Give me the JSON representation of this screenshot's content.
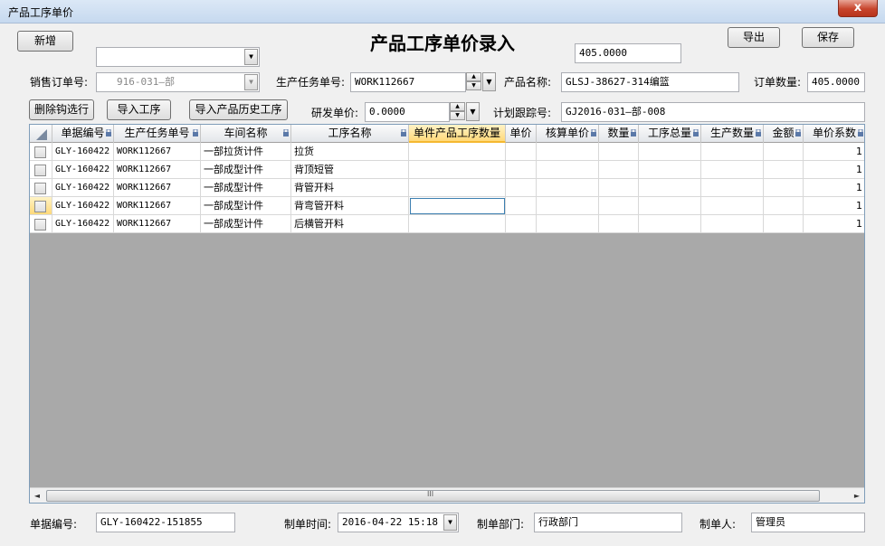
{
  "window": {
    "title": "产品工序单价",
    "close_label": "x"
  },
  "toolbar": {
    "add_label": "新增",
    "export_label": "导出",
    "save_label": "保存"
  },
  "header": {
    "title": "产品工序单价录入",
    "top_value": "405.0000",
    "customer_value": ""
  },
  "form": {
    "sales_order_label": "销售订单号:",
    "sales_order_value": "916-031—部",
    "task_no_label": "生产任务单号:",
    "task_no_value": "WORK112667",
    "product_name_label": "产品名称:",
    "product_name_value": "GLSJ-38627-314编篮",
    "order_qty_label": "订单数量:",
    "order_qty_value": "405.0000",
    "delete_checked_label": "删除钩选行",
    "import_process_label": "导入工序",
    "import_history_label": "导入产品历史工序",
    "rd_price_label": "研发单价:",
    "rd_price_value": "0.0000",
    "plan_track_label": "计划跟踪号:",
    "plan_track_value": "GJ2016-031—部-008"
  },
  "grid": {
    "columns": [
      "单据编号",
      "生产任务单号",
      "车间名称",
      "工序名称",
      "单件产品工序数量",
      "单价",
      "核算单价",
      "数量",
      "工序总量",
      "生产数量",
      "金额",
      "单价系数"
    ],
    "rows": [
      {
        "doc_no": "GLY-160422",
        "task_no": "WORK112667",
        "workshop": "一部拉货计件",
        "process": "拉货",
        "coef": "1"
      },
      {
        "doc_no": "GLY-160422",
        "task_no": "WORK112667",
        "workshop": "一部成型计件",
        "process": "背顶短管",
        "coef": "1"
      },
      {
        "doc_no": "GLY-160422",
        "task_no": "WORK112667",
        "workshop": "一部成型计件",
        "process": "背管开料",
        "coef": "1"
      },
      {
        "doc_no": "GLY-160422",
        "task_no": "WORK112667",
        "workshop": "一部成型计件",
        "process": "背弯管开料",
        "coef": "1"
      },
      {
        "doc_no": "GLY-160422",
        "task_no": "WORK112667",
        "workshop": "一部成型计件",
        "process": "后横管开料",
        "coef": "1"
      }
    ],
    "scroll_grip": "III"
  },
  "footer": {
    "doc_no_label": "单据编号:",
    "doc_no_value": "GLY-160422-151855",
    "created_time_label": "制单时间:",
    "created_time_value": "2016-04-22 15:18",
    "dept_label": "制单部门:",
    "dept_value": "行政部门",
    "creator_label": "制单人:",
    "creator_value": "管理员"
  },
  "colors": {
    "active_header": "#ffd97a",
    "grid_empty": "#a9a9a9",
    "title_bar": "#c6d9ef"
  }
}
